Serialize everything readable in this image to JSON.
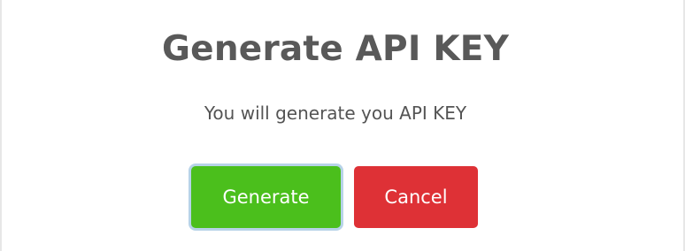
{
  "dialog": {
    "title": "Generate API KEY",
    "message": "You will generate you API KEY"
  },
  "actions": {
    "confirm_label": "Generate",
    "cancel_label": "Cancel"
  },
  "colors": {
    "confirm_button": "#4bbf1c",
    "cancel_button": "#de3136",
    "focus_ring": "#b7d3e8",
    "title_text": "#595959"
  }
}
